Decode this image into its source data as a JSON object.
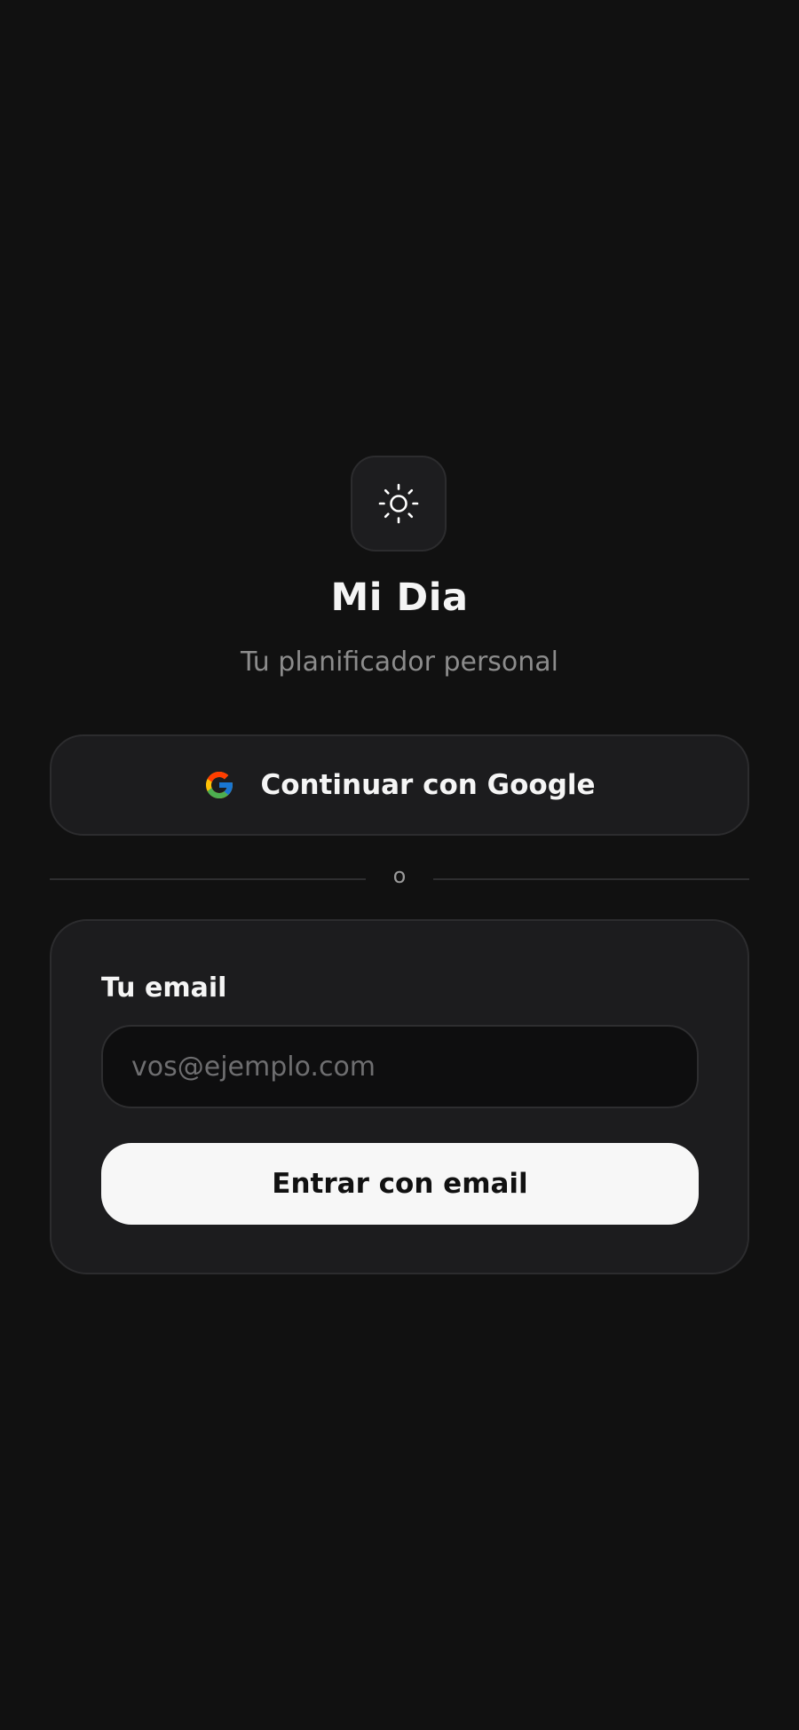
{
  "app": {
    "logo_icon": "sun-icon",
    "title": "Mi Dia",
    "subtitle": "Tu planificador personal"
  },
  "google_login": {
    "icon": "google-icon",
    "label": "Continuar con Google"
  },
  "divider": {
    "text": "o"
  },
  "email_form": {
    "label": "Tu email",
    "value": "",
    "placeholder": "vos@ejemplo.com",
    "submit_label": "Entrar con email"
  },
  "colors": {
    "background": "#111111",
    "surface": "#1c1c1e",
    "border": "#2c2c2e",
    "text_primary": "#f5f5f5",
    "text_secondary": "#8c8c8c",
    "button_primary_bg": "#f7f7f7",
    "button_primary_text": "#111111"
  }
}
